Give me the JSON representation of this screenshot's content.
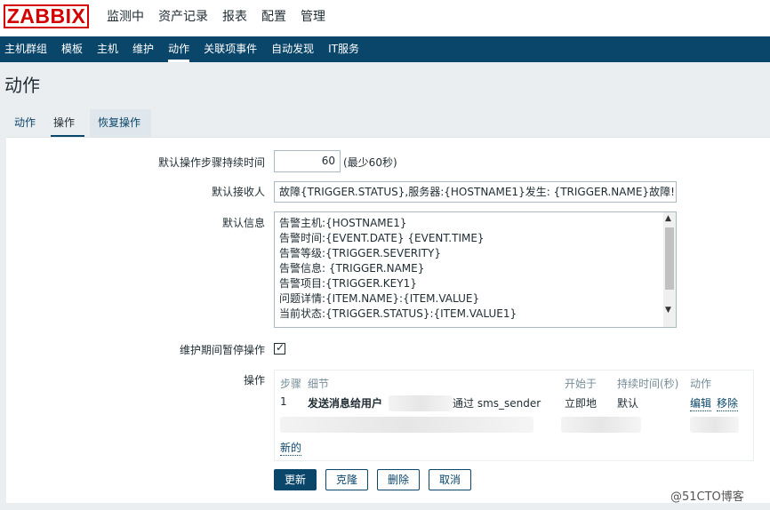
{
  "header": {
    "logo": "ZABBIX",
    "menu": [
      "监测中",
      "资产记录",
      "报表",
      "配置",
      "管理"
    ],
    "active_menu": "配置"
  },
  "submenu": {
    "items": [
      "主机群组",
      "模板",
      "主机",
      "维护",
      "动作",
      "关联项事件",
      "自动发现",
      "IT服务"
    ],
    "active": "动作"
  },
  "page_title": "动作",
  "tabs": [
    "动作",
    "操作",
    "恢复操作"
  ],
  "form": {
    "duration_label": "默认操作步骤持续时间",
    "duration_value": "60",
    "duration_hint": "(最少60秒)",
    "subject_label": "默认接收人",
    "subject_value": "故障{TRIGGER.STATUS},服务器:{HOSTNAME1}发生: {TRIGGER.NAME}故障!",
    "message_label": "默认信息",
    "message_lines": [
      "告警主机:{HOSTNAME1}",
      "告警时间:{EVENT.DATE} {EVENT.TIME}",
      "告警等级:{TRIGGER.SEVERITY}",
      "告警信息: {TRIGGER.NAME}",
      "告警项目:{TRIGGER.KEY1}",
      "问题详情:{ITEM.NAME}:{ITEM.VALUE}",
      "当前状态:{TRIGGER.STATUS}:{ITEM.VALUE1}"
    ],
    "pause_label": "维护期间暂停操作",
    "pause_checked": true,
    "ops_label": "操作"
  },
  "operations": {
    "headers": [
      "步骤",
      "细节",
      "开始于",
      "持续时间(秒)",
      "动作"
    ],
    "row": {
      "step": "1",
      "detail_prefix": "发送消息给用户",
      "detail_suffix": "通过 sms_sender",
      "start": "立即地",
      "duration": "默认",
      "edit": "编辑",
      "remove": "移除"
    },
    "new_link": "新的"
  },
  "buttons": {
    "update": "更新",
    "clone": "克隆",
    "delete": "删除",
    "cancel": "取消"
  },
  "watermark": "@51CTO博客"
}
